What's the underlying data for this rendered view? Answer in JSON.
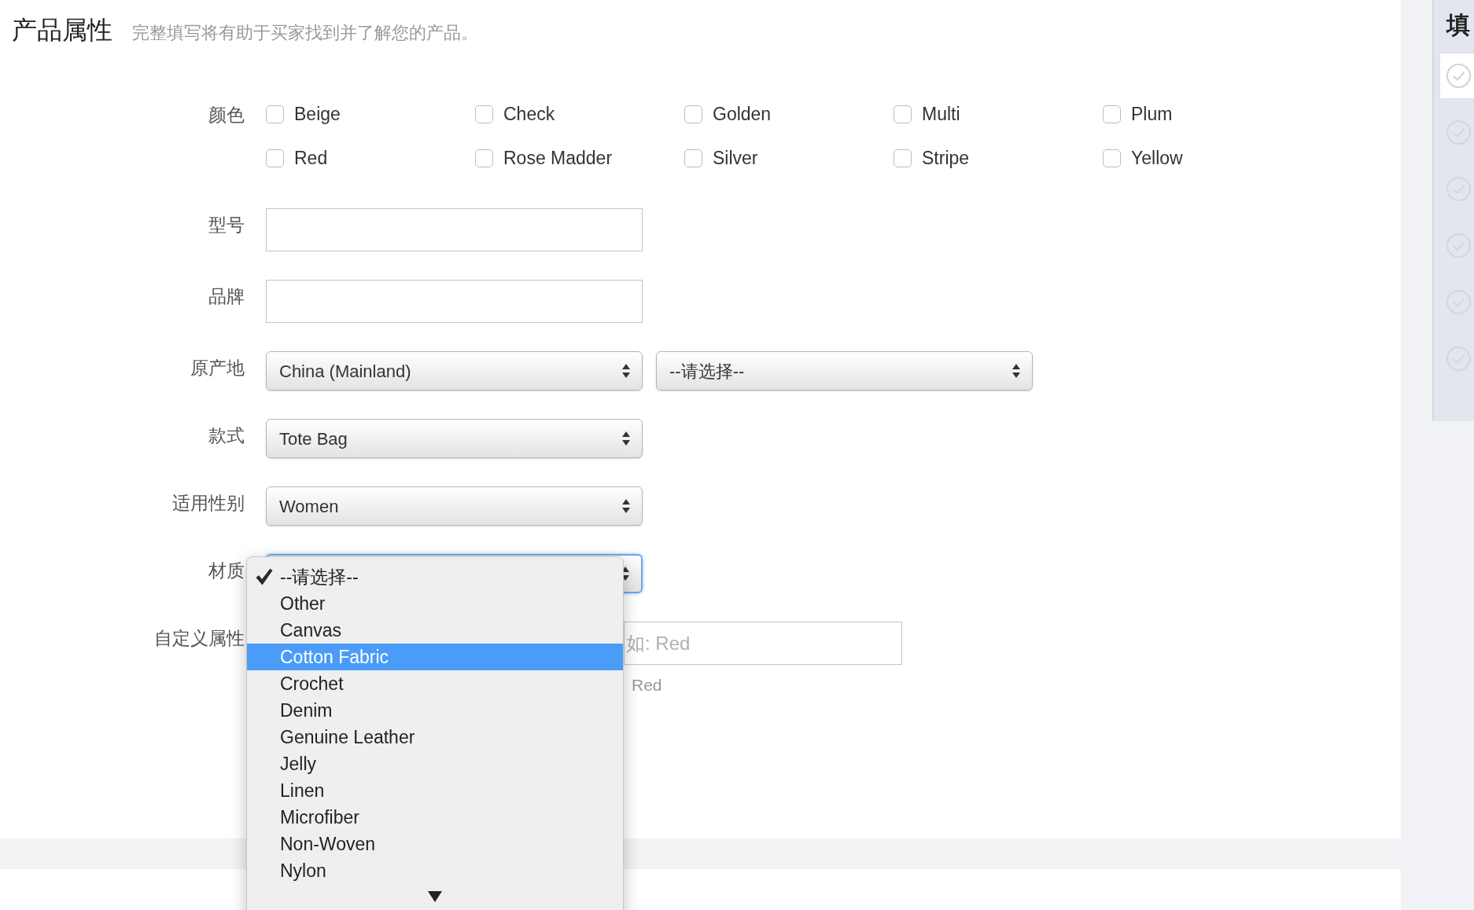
{
  "header": {
    "title": "产品属性",
    "subtitle": "完整填写将有助于买家找到并了解您的产品。"
  },
  "form": {
    "rows": [
      {
        "kind": "checkboxes",
        "label": "颜色",
        "options": [
          {
            "label": "Beige",
            "checked": false
          },
          {
            "label": "Check",
            "checked": false
          },
          {
            "label": "Golden",
            "checked": false
          },
          {
            "label": "Multi",
            "checked": false
          },
          {
            "label": "Plum",
            "checked": false
          },
          {
            "label": "Red",
            "checked": false
          },
          {
            "label": "Rose Madder",
            "checked": false
          },
          {
            "label": "Silver",
            "checked": false
          },
          {
            "label": "Stripe",
            "checked": false
          },
          {
            "label": "Yellow",
            "checked": false
          }
        ]
      },
      {
        "kind": "input",
        "label": "型号"
      },
      {
        "kind": "input",
        "label": "品牌"
      },
      {
        "kind": "select",
        "label": "原产地",
        "selects": [
          {
            "value": "China (Mainland)",
            "focused": false
          },
          {
            "value": "--请选择--",
            "focused": false
          }
        ]
      },
      {
        "kind": "select",
        "label": "款式",
        "selects": [
          {
            "value": "Tote Bag",
            "focused": false
          }
        ]
      },
      {
        "kind": "select",
        "label": "适用性别",
        "selects": [
          {
            "value": "Women",
            "focused": false
          }
        ]
      },
      {
        "kind": "select",
        "label": "材质",
        "selects": [
          {
            "focused": true
          }
        ]
      },
      {
        "kind": "custom",
        "label": "自定义属性",
        "placeholder": "如: Red",
        "hint": "Red"
      }
    ]
  },
  "dropdown": {
    "options": [
      {
        "label": "--请选择--",
        "selected": true,
        "highlighted": false
      },
      {
        "label": "Other",
        "selected": false,
        "highlighted": false
      },
      {
        "label": "Canvas",
        "selected": false,
        "highlighted": false
      },
      {
        "label": "Cotton Fabric",
        "selected": false,
        "highlighted": true
      },
      {
        "label": "Crochet",
        "selected": false,
        "highlighted": false
      },
      {
        "label": "Denim",
        "selected": false,
        "highlighted": false
      },
      {
        "label": "Genuine Leather",
        "selected": false,
        "highlighted": false
      },
      {
        "label": "Jelly",
        "selected": false,
        "highlighted": false
      },
      {
        "label": "Linen",
        "selected": false,
        "highlighted": false
      },
      {
        "label": "Microfiber",
        "selected": false,
        "highlighted": false
      },
      {
        "label": "Non-Woven",
        "selected": false,
        "highlighted": false
      },
      {
        "label": "Nylon",
        "selected": false,
        "highlighted": false
      }
    ]
  },
  "sidebar": {
    "title": "填",
    "items": [
      {
        "selected": true
      },
      {
        "selected": false
      },
      {
        "selected": false
      },
      {
        "selected": false
      },
      {
        "selected": false
      },
      {
        "selected": false
      }
    ]
  }
}
